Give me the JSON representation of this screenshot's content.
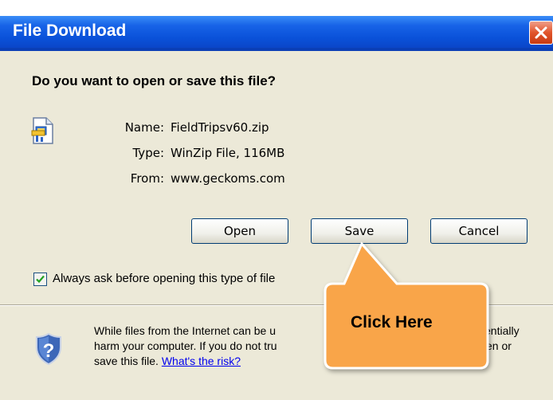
{
  "window": {
    "title": "File Download",
    "close_icon": "close-icon"
  },
  "dialog": {
    "question": "Do you want to open or save this file?",
    "file_icon": "zip-file-icon",
    "info": {
      "name_label": "Name:",
      "name_value": "FieldTripsv60.zip",
      "type_label": "Type:",
      "type_value": "WinZip File, 116MB",
      "from_label": "From:",
      "from_value": "www.geckoms.com"
    },
    "buttons": {
      "open": "Open",
      "save": "Save",
      "cancel": "Cancel"
    },
    "checkbox": {
      "label": "Always ask before opening this type of file",
      "checked": true
    },
    "warning": {
      "icon": "shield-question-icon",
      "line1_a": "While files from the Internet can be u",
      "line1_b": "entially",
      "line2_a": "harm your computer. If you do not tru",
      "line2_b": "en or",
      "line3": "save this file.",
      "risk_link": "What's the risk?"
    }
  },
  "callout": {
    "text": "Click Here",
    "color": "#f9a548"
  }
}
